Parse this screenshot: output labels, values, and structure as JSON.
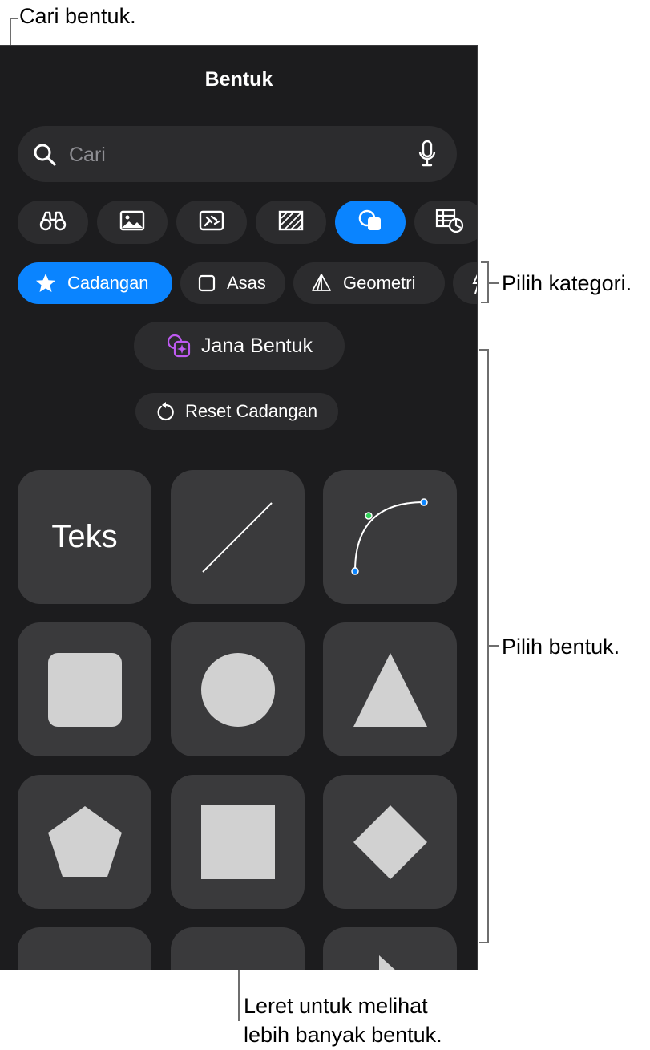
{
  "annotations": {
    "search": "Cari bentuk.",
    "category": "Pilih kategori.",
    "shapes": "Pilih bentuk.",
    "scroll_line1": "Leret untuk melihat",
    "scroll_line2": "lebih banyak bentuk."
  },
  "panel": {
    "title": "Bentuk",
    "search_placeholder": "Cari"
  },
  "tabs": [
    {
      "icon": "binoculars-icon",
      "active": false
    },
    {
      "icon": "photo-icon",
      "active": false
    },
    {
      "icon": "sticker-icon",
      "active": false
    },
    {
      "icon": "texture-icon",
      "active": false
    },
    {
      "icon": "shapes-icon",
      "active": true
    },
    {
      "icon": "table-chart-icon",
      "active": false
    }
  ],
  "categories": [
    {
      "label": "Cadangan",
      "icon": "star-icon",
      "active": true
    },
    {
      "label": "Asas",
      "icon": "square-outline-icon",
      "active": false
    },
    {
      "label": "Geometri",
      "icon": "pyramid-icon",
      "active": false
    }
  ],
  "actions": {
    "generate_label": "Jana Bentuk",
    "reset_label": "Reset Cadangan"
  },
  "shapes": {
    "text_tile_label": "Teks"
  },
  "colors": {
    "accent": "#0a84ff",
    "panel_bg": "#1c1c1e",
    "tile_bg": "#3a3a3c",
    "shape_fill": "#d1d1d1"
  }
}
